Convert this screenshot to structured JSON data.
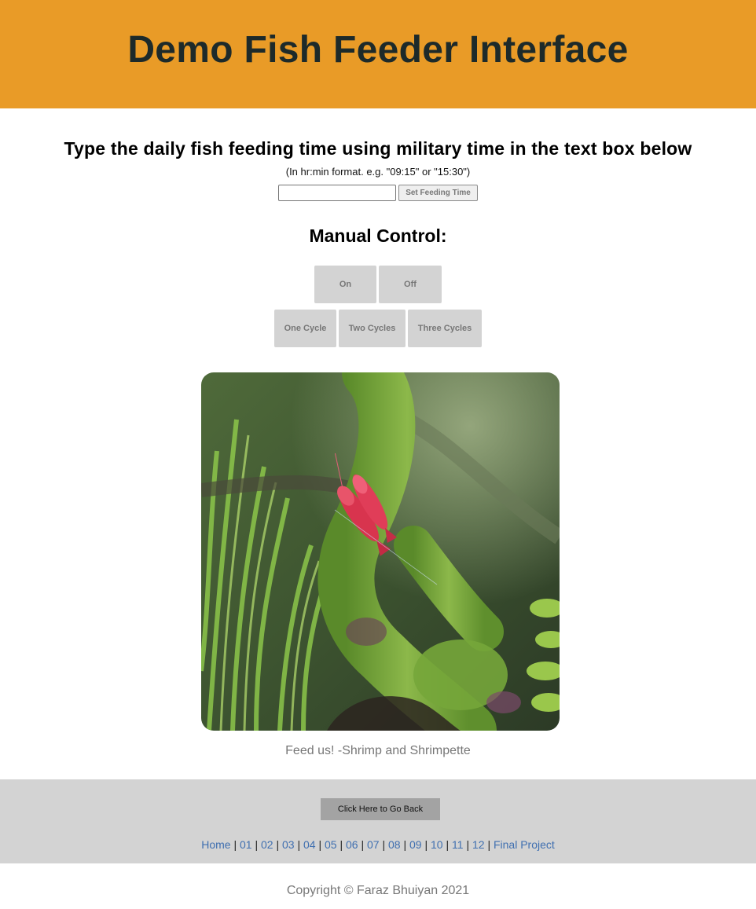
{
  "header": {
    "title": "Demo Fish Feeder Interface",
    "bg_color": "#e99b27"
  },
  "feeding": {
    "instruction": "Type the daily fish feeding time using military time in the text box below",
    "format_hint": "(In hr:min format. e.g. \"09:15\" or \"15:30\")",
    "input_value": "",
    "set_button_label": "Set Feeding Time"
  },
  "manual": {
    "title": "Manual Control:",
    "on_label": "On",
    "off_label": "Off",
    "one_cycle_label": "One Cycle",
    "two_cycles_label": "Two Cycles",
    "three_cycles_label": "Three Cycles"
  },
  "photo": {
    "icon": "shrimp-photo",
    "caption": "Feed us! -Shrimp and Shrimpette"
  },
  "footer": {
    "back_button_label": "Click Here to Go Back",
    "separator": "|",
    "links": [
      "Home",
      "01",
      "02",
      "03",
      "04",
      "05",
      "06",
      "07",
      "08",
      "09",
      "10",
      "11",
      "12",
      "Final Project"
    ],
    "link_color": "#3f6fb0",
    "copyright": "Copyright © Faraz Bhuiyan 2021"
  }
}
